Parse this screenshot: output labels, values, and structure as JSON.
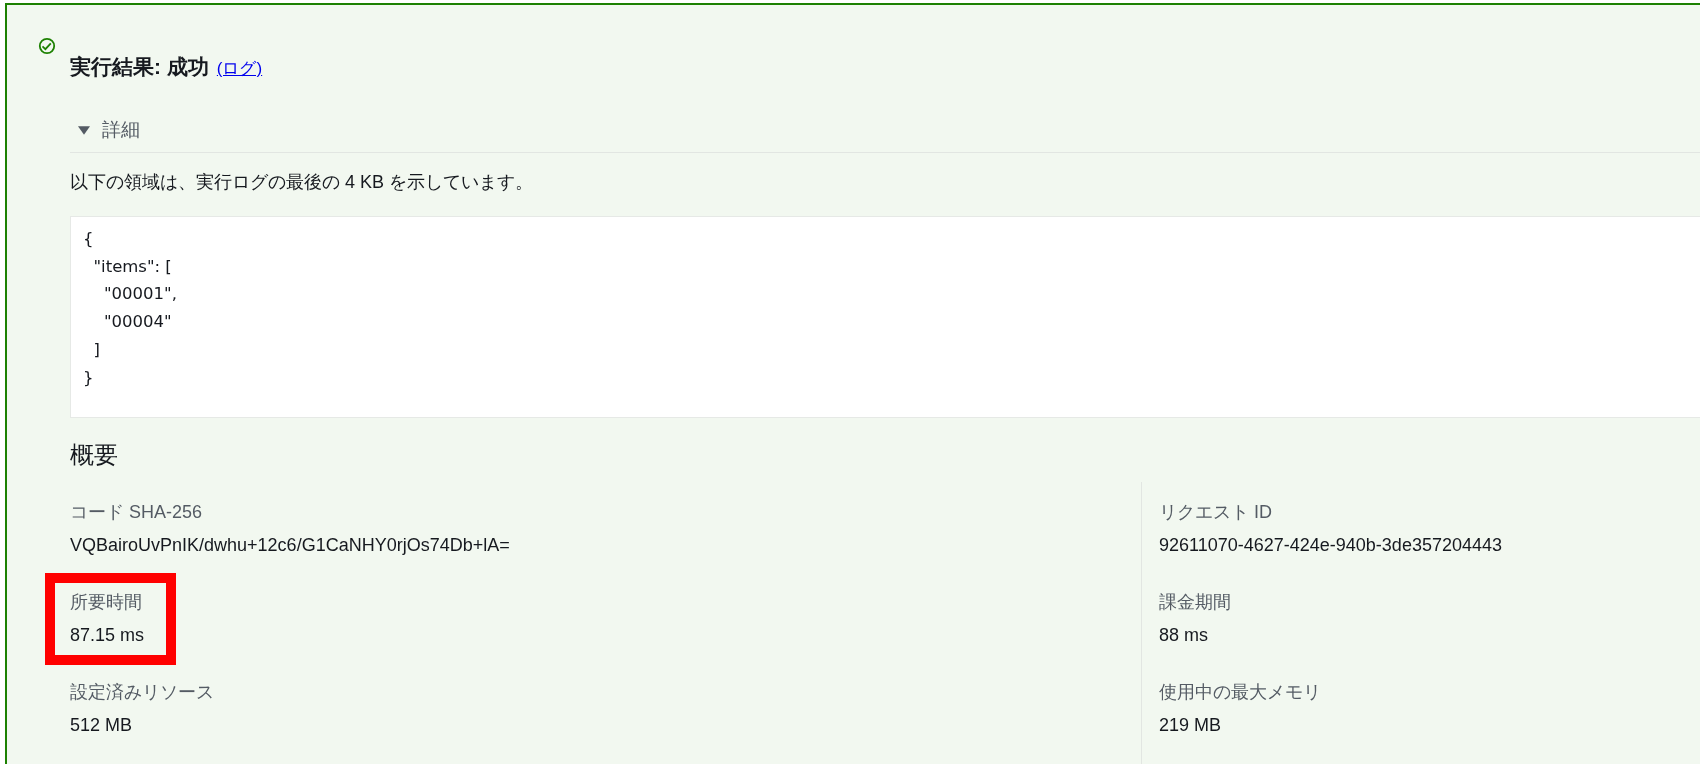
{
  "result": {
    "title": "実行結果: 成功",
    "log_link": "(ログ)"
  },
  "details": {
    "label": "詳細",
    "expanded": true,
    "description": "以下の領域は、実行ログの最後の 4 KB を示しています。",
    "log_output": [
      "{",
      "  \"items\": [",
      "    \"00001\",",
      "    \"00004\"",
      "  ]",
      "}"
    ]
  },
  "summary": {
    "heading": "概要",
    "columns": [
      [
        {
          "label": "コード SHA-256",
          "value": "VQBairoUvPnIK/dwhu+12c6/G1CaNHY0rjOs74Db+lA="
        },
        {
          "label": "所要時間",
          "value": "87.15 ms",
          "highlighted": true
        },
        {
          "label": "設定済みリソース",
          "value": "512 MB"
        }
      ],
      [
        {
          "label": "リクエスト ID",
          "value": "92611070-4627-424e-940b-3de357204443"
        },
        {
          "label": "課金期間",
          "value": "88 ms"
        },
        {
          "label": "使用中の最大メモリ",
          "value": "219 MB"
        }
      ]
    ]
  }
}
